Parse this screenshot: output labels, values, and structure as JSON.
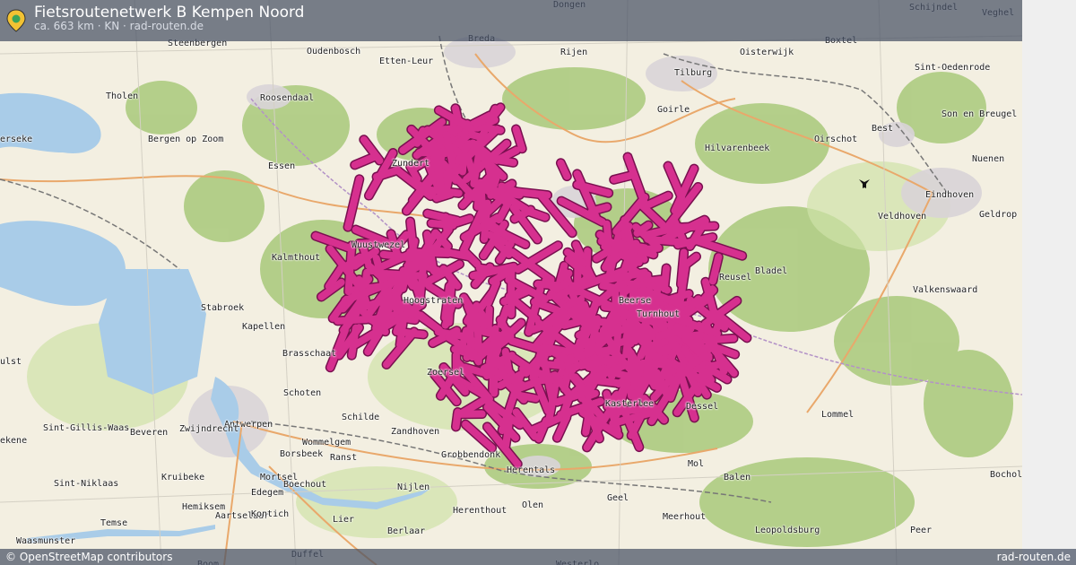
{
  "header": {
    "title": "Fietsroutenetwerk B Kempen Noord",
    "subtitle": "ca. 663 km · KN · rad-routen.de"
  },
  "footer": {
    "attribution": "© OpenStreetMap contributors",
    "brand": "rad-routen.de"
  },
  "map": {
    "route_color": "#d6308f",
    "route_outline": "#7a1050",
    "water_color": "#a9cce8",
    "land_color": "#f3efe1",
    "forest_color": "#a8c97a",
    "places": [
      {
        "name": "Dongen"
      },
      {
        "name": "Schijndel"
      },
      {
        "name": "Veghel"
      },
      {
        "name": "Steenbergen"
      },
      {
        "name": "Breda"
      },
      {
        "name": "Boxtel"
      },
      {
        "name": "Oudenbosch"
      },
      {
        "name": "Etten-Leur"
      },
      {
        "name": "Rijen"
      },
      {
        "name": "Oisterwijk"
      },
      {
        "name": "Sint-Oedenrode"
      },
      {
        "name": "Tilburg"
      },
      {
        "name": "Tholen"
      },
      {
        "name": "Roosendaal"
      },
      {
        "name": "Goirle"
      },
      {
        "name": "Son en Breugel"
      },
      {
        "name": "erseke"
      },
      {
        "name": "Bergen op Zoom"
      },
      {
        "name": "Hilvarenbeek"
      },
      {
        "name": "Oirschot"
      },
      {
        "name": "Best"
      },
      {
        "name": "Zundert"
      },
      {
        "name": "Essen"
      },
      {
        "name": "Nuenen"
      },
      {
        "name": "Eindhoven"
      },
      {
        "name": "Veldhoven"
      },
      {
        "name": "Geldrop"
      },
      {
        "name": "Wuustwezel"
      },
      {
        "name": "Kalmthout"
      },
      {
        "name": "Bladel"
      },
      {
        "name": "Reusel"
      },
      {
        "name": "Valkenswaard"
      },
      {
        "name": "Stabroek"
      },
      {
        "name": "Kapellen"
      },
      {
        "name": "Brasschaat"
      },
      {
        "name": "Zoersel"
      },
      {
        "name": "ulst"
      },
      {
        "name": "Schoten"
      },
      {
        "name": "Kasterlee"
      },
      {
        "name": "Dessel"
      },
      {
        "name": "Schilde"
      },
      {
        "name": "Lommel"
      },
      {
        "name": "Antwerpen"
      },
      {
        "name": "ekene"
      },
      {
        "name": "Sint-Gillis-Waas"
      },
      {
        "name": "Beveren"
      },
      {
        "name": "Zwijndrecht"
      },
      {
        "name": "Zandhoven"
      },
      {
        "name": "Wommelgem"
      },
      {
        "name": "Borsbeek"
      },
      {
        "name": "Ranst"
      },
      {
        "name": "Grobbendonk"
      },
      {
        "name": "Kruibeke"
      },
      {
        "name": "Mortsel"
      },
      {
        "name": "Herentals"
      },
      {
        "name": "Mol"
      },
      {
        "name": "Bocholt"
      },
      {
        "name": "Sint-Niklaas"
      },
      {
        "name": "Boechout"
      },
      {
        "name": "Balen"
      },
      {
        "name": "Edegem"
      },
      {
        "name": "Nijlen"
      },
      {
        "name": "Hemiksem"
      },
      {
        "name": "Aartselaar"
      },
      {
        "name": "Kontich"
      },
      {
        "name": "Geel"
      },
      {
        "name": "Temse"
      },
      {
        "name": "Herenthout"
      },
      {
        "name": "Olen"
      },
      {
        "name": "Lier"
      },
      {
        "name": "Meerhout"
      },
      {
        "name": "Waasmunster"
      },
      {
        "name": "Berlaar"
      },
      {
        "name": "Leopoldsburg"
      },
      {
        "name": "Peer"
      },
      {
        "name": "Duffel"
      },
      {
        "name": "Boom"
      },
      {
        "name": "Westerlo"
      },
      {
        "name": "Turnhout"
      },
      {
        "name": "Beerse"
      },
      {
        "name": "Hoogstraten"
      }
    ]
  }
}
